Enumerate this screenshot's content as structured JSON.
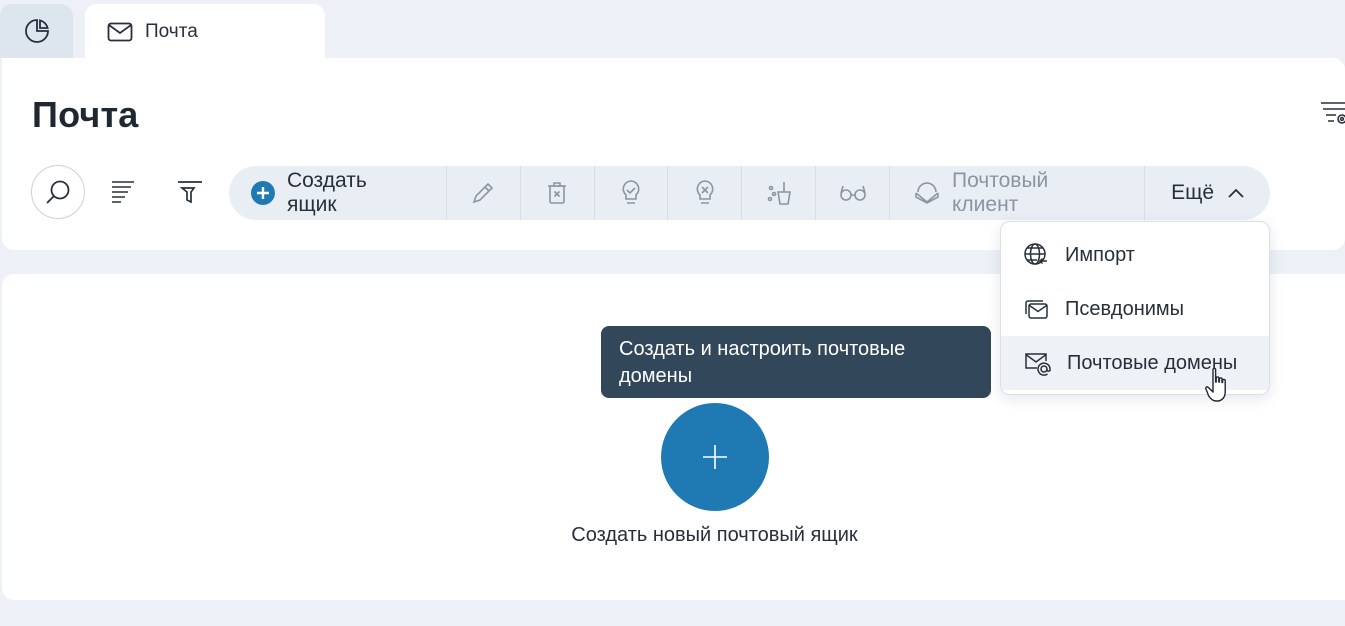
{
  "tabs": [
    {
      "label": "",
      "icon": "pie-chart-icon"
    },
    {
      "label": "Почта",
      "icon": "envelope-icon"
    }
  ],
  "page": {
    "title": "Почта"
  },
  "toolbar": {
    "create_label": "Создать ящик",
    "icons": [
      "pencil-icon",
      "trash-icon",
      "bulb-check-icon",
      "bulb-x-icon",
      "broom-icon",
      "glasses-icon"
    ],
    "client_label": "Почтовый клиент",
    "more_label": "Ещё"
  },
  "dropdown": {
    "items": [
      {
        "label": "Импорт",
        "icon": "globe-import-icon"
      },
      {
        "label": "Псевдонимы",
        "icon": "stacked-mail-icon"
      },
      {
        "label": "Почтовые домены",
        "icon": "mail-at-icon"
      }
    ]
  },
  "tooltip": {
    "text": "Создать и настроить почтовые домены"
  },
  "empty_state": {
    "label": "Создать новый почтовый ящик"
  },
  "colors": {
    "accent": "#1f7ab4",
    "tooltip_bg": "#33475a",
    "page_bg": "#edf1f7",
    "toolbar_bg": "#e9eef5"
  }
}
